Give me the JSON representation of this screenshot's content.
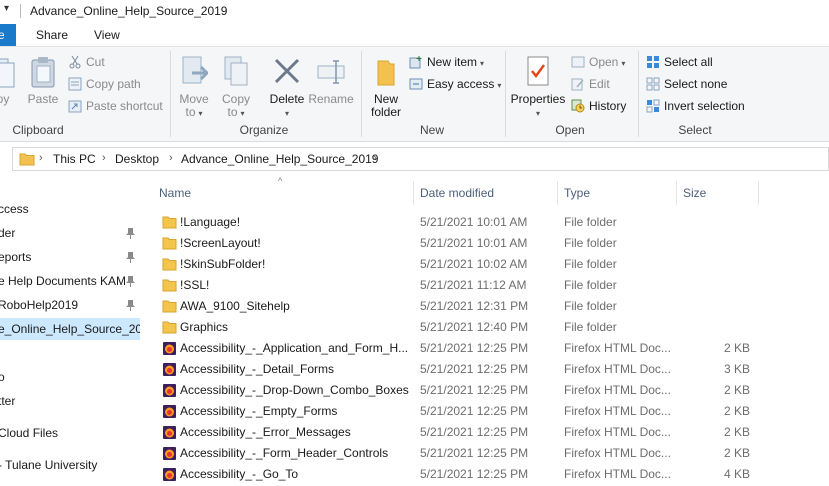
{
  "window": {
    "title": "Advance_Online_Help_Source_2019"
  },
  "ribbon_tabs": [
    "e",
    "Share",
    "View"
  ],
  "clipboard": {
    "label": "Clipboard",
    "copy_label": "py",
    "paste_label": "Paste",
    "cut_label": "Cut",
    "copy_path_label": "Copy path",
    "paste_shortcut_label": "Paste shortcut"
  },
  "organize": {
    "label": "Organize",
    "move_to": [
      "Move",
      "to"
    ],
    "copy_to": [
      "Copy",
      "to"
    ],
    "delete_label": "Delete",
    "rename_label": "Rename"
  },
  "new": {
    "label": "New",
    "new_folder": [
      "New",
      "folder"
    ],
    "new_item_label": "New item",
    "easy_access_label": "Easy access"
  },
  "open": {
    "label": "Open",
    "properties_label": "Properties",
    "open_label": "Open",
    "edit_label": "Edit",
    "history_label": "History"
  },
  "select": {
    "label": "Select",
    "select_all_label": "Select all",
    "select_none_label": "Select none",
    "invert_selection_label": "Invert selection"
  },
  "breadcrumb": [
    "This PC",
    "Desktop",
    "Advance_Online_Help_Source_2019"
  ],
  "nav_items": [
    {
      "label": "ccess",
      "pinned": false,
      "selected": false
    },
    {
      "label": "der",
      "pinned": true,
      "selected": false
    },
    {
      "label": "eports",
      "pinned": true,
      "selected": false
    },
    {
      "label": "e Help Documents KAM",
      "pinned": true,
      "selected": false
    },
    {
      "label": "RoboHelp2019",
      "pinned": true,
      "selected": false
    },
    {
      "label": "e_Online_Help_Source_201",
      "pinned": false,
      "selected": true
    },
    {
      "label": "",
      "pinned": false,
      "selected": false
    },
    {
      "label": "o",
      "pinned": false,
      "selected": false
    },
    {
      "label": "tter",
      "pinned": false,
      "selected": false
    },
    {
      "label": "Cloud Files",
      "pinned": false,
      "selected": false
    },
    {
      "label": "- Tulane University",
      "pinned": false,
      "selected": false
    }
  ],
  "columns": {
    "name": "Name",
    "date": "Date modified",
    "type": "Type",
    "size": "Size"
  },
  "files": [
    {
      "icon": "folder-icon",
      "name": "!Language!",
      "date": "5/21/2021 10:01 AM",
      "type": "File folder",
      "size": ""
    },
    {
      "icon": "folder-icon",
      "name": "!ScreenLayout!",
      "date": "5/21/2021 10:01 AM",
      "type": "File folder",
      "size": ""
    },
    {
      "icon": "folder-icon",
      "name": "!SkinSubFolder!",
      "date": "5/21/2021 10:02 AM",
      "type": "File folder",
      "size": ""
    },
    {
      "icon": "folder-icon",
      "name": "!SSL!",
      "date": "5/21/2021 11:12 AM",
      "type": "File folder",
      "size": ""
    },
    {
      "icon": "folder-icon",
      "name": "AWA_9100_Sitehelp",
      "date": "5/21/2021 12:31 PM",
      "type": "File folder",
      "size": ""
    },
    {
      "icon": "folder-icon",
      "name": "Graphics",
      "date": "5/21/2021 12:40 PM",
      "type": "File folder",
      "size": ""
    },
    {
      "icon": "firefox-html-icon",
      "name": "Accessibility_-_Application_and_Form_H...",
      "date": "5/21/2021 12:25 PM",
      "type": "Firefox HTML Doc...",
      "size": "2 KB"
    },
    {
      "icon": "firefox-html-icon",
      "name": "Accessibility_-_Detail_Forms",
      "date": "5/21/2021 12:25 PM",
      "type": "Firefox HTML Doc...",
      "size": "3 KB"
    },
    {
      "icon": "firefox-html-icon",
      "name": "Accessibility_-_Drop-Down_Combo_Boxes",
      "date": "5/21/2021 12:25 PM",
      "type": "Firefox HTML Doc...",
      "size": "2 KB"
    },
    {
      "icon": "firefox-html-icon",
      "name": "Accessibility_-_Empty_Forms",
      "date": "5/21/2021 12:25 PM",
      "type": "Firefox HTML Doc...",
      "size": "2 KB"
    },
    {
      "icon": "firefox-html-icon",
      "name": "Accessibility_-_Error_Messages",
      "date": "5/21/2021 12:25 PM",
      "type": "Firefox HTML Doc...",
      "size": "2 KB"
    },
    {
      "icon": "firefox-html-icon",
      "name": "Accessibility_-_Form_Header_Controls",
      "date": "5/21/2021 12:25 PM",
      "type": "Firefox HTML Doc...",
      "size": "2 KB"
    },
    {
      "icon": "firefox-html-icon",
      "name": "Accessibility_-_Go_To",
      "date": "5/21/2021 12:25 PM",
      "type": "Firefox HTML Doc...",
      "size": "4 KB"
    }
  ],
  "colors": {
    "accent": "#1979ca",
    "folder": "#f4c54d",
    "selection": "#cce8ff"
  }
}
